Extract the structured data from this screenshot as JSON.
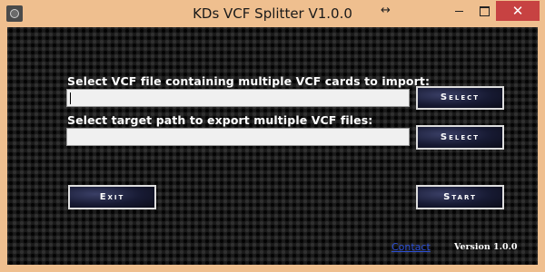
{
  "window": {
    "title": "KDs VCF Splitter V1.0.0",
    "close_glyph": "✕",
    "resize_glyph": "↔"
  },
  "form": {
    "import_label": "Select VCF file containing multiple VCF cards to import:",
    "import_value": "",
    "import_button": "Select",
    "export_label": "Select target path to export multiple VCF files:",
    "export_value": "",
    "export_button": "Select"
  },
  "actions": {
    "exit_label": "Exit",
    "start_label": "Start"
  },
  "footer": {
    "contact_link": "Contact",
    "version": "Version 1.0.0"
  },
  "colors": {
    "title_bar": "#efbf8f",
    "close_button": "#c74242",
    "button_fill": "#1b1e3a",
    "link": "#2c4fd6"
  },
  "icons": {
    "app": "app-icon",
    "minimize": "minimize-icon",
    "maximize": "maximize-icon",
    "close": "close-icon",
    "resize": "resize-cursor-icon"
  }
}
